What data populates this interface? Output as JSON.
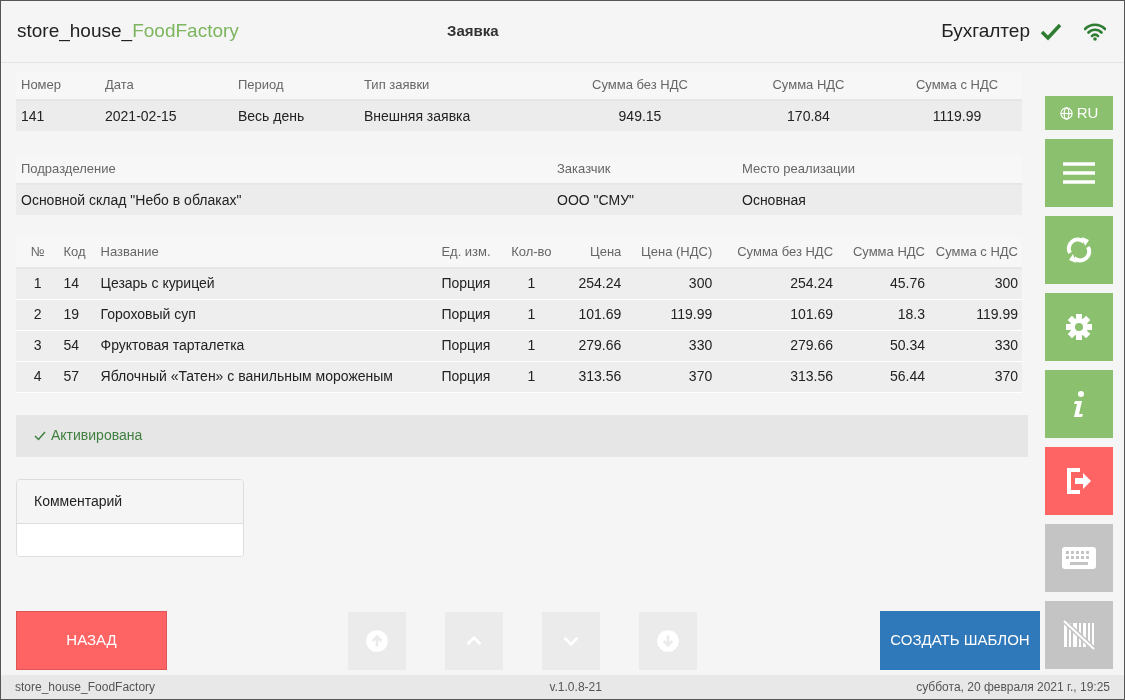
{
  "header": {
    "app_name": "store_house_",
    "app_name_accent": "FoodFactory",
    "title": "Заявка",
    "user": "Бухгалтер",
    "connected": true
  },
  "order_summary": {
    "columns": [
      "Номер",
      "Дата",
      "Период",
      "Тип заявки",
      "Сумма без НДС",
      "Сумма НДС",
      "Сумма с НДС"
    ],
    "values": [
      "141",
      "2021-02-15",
      "Весь день",
      "Внешняя заявка",
      "949.15",
      "170.84",
      "1119.99"
    ]
  },
  "details": {
    "columns": [
      "Подразделение",
      "Заказчик",
      "Место реализации"
    ],
    "values": [
      "Основной склад \"Небо в облаках\"",
      "ООО \"СМУ\"",
      "Основная"
    ]
  },
  "items": {
    "columns": [
      "№",
      "Код",
      "Название",
      "Ед. изм.",
      "Кол-во",
      "Цена",
      "Цена (НДС)",
      "Сумма без НДС",
      "Сумма НДС",
      "Сумма с НДС"
    ],
    "rows": [
      [
        "1",
        "14",
        "Цезарь с курицей",
        "Порция",
        "1",
        "254.24",
        "300",
        "254.24",
        "45.76",
        "300"
      ],
      [
        "2",
        "19",
        "Гороховый суп",
        "Порция",
        "1",
        "101.69",
        "119.99",
        "101.69",
        "18.3",
        "119.99"
      ],
      [
        "3",
        "54",
        "Фруктовая тарталетка",
        "Порция",
        "1",
        "279.66",
        "330",
        "279.66",
        "50.34",
        "330"
      ],
      [
        "4",
        "57",
        "Яблочный «Татен» с ванильным мороженым",
        "Порция",
        "1",
        "313.56",
        "370",
        "313.56",
        "56.44",
        "370"
      ]
    ]
  },
  "status": {
    "label": "Активирована",
    "active": true
  },
  "comment": {
    "label": "Комментарий"
  },
  "back_button": "НАЗАД",
  "nav_buttons": [
    {
      "kind": "first",
      "disabled": true
    },
    {
      "kind": "up",
      "disabled": true
    },
    {
      "kind": "down",
      "disabled": true
    },
    {
      "kind": "last",
      "disabled": true
    }
  ],
  "create_button": "СОЗДАТЬ ШАБЛОН",
  "sidebar": [
    {
      "kind": "language",
      "label": "RU",
      "disabled": false
    },
    {
      "kind": "menu",
      "disabled": false
    },
    {
      "kind": "refresh",
      "disabled": false
    },
    {
      "kind": "settings",
      "disabled": false
    },
    {
      "kind": "info",
      "disabled": false
    },
    {
      "kind": "logout",
      "disabled": false
    },
    {
      "kind": "keyboard",
      "disabled": true
    },
    {
      "kind": "barcode",
      "disabled": true
    }
  ],
  "status_bar": {
    "left": "store_house_FoodFactory",
    "center": "v.1.0.8-21",
    "right": "суббота, 20 февраля 2021 г., 19:25"
  }
}
